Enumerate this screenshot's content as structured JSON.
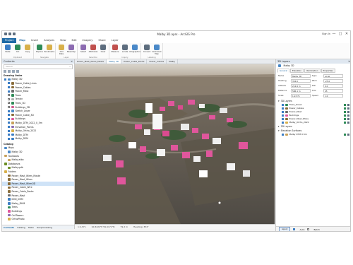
{
  "window": {
    "title": "Malby 3D.aprx - ArcGIS Pro",
    "sign_in": "Sign In",
    "min": "—",
    "max": "□",
    "close": "✕"
  },
  "ribbon_tabs": [
    "Project",
    "Map",
    "Insert",
    "Analysis",
    "View",
    "Edit",
    "Imagery",
    "Share",
    "Layer"
  ],
  "ribbon": {
    "groups": [
      {
        "name": "Clipboard",
        "buttons": [
          "Paste",
          "Cut",
          "Copy"
        ]
      },
      {
        "name": "Navigate",
        "buttons": [
          "Explore",
          "Bookmarks"
        ]
      },
      {
        "name": "Layer",
        "buttons": [
          "Add Data",
          "Basemap"
        ]
      },
      {
        "name": "Selection",
        "buttons": [
          "Select",
          "Attributes",
          "Clear"
        ]
      },
      {
        "name": "Inquiry",
        "buttons": [
          "Measure",
          "Locate",
          "Infographics"
        ]
      },
      {
        "name": "Labeling",
        "buttons": [
          "Convert",
          "Download Map"
        ]
      }
    ]
  },
  "left_pane": {
    "title": "Contents",
    "search_placeholder": "Search",
    "section_label": "Drawing Order",
    "items": [
      {
        "label": "Malby 3D",
        "level": 0,
        "checked": true,
        "color": "#4a89c8"
      },
      {
        "label": "Power_Cable_Lines",
        "level": 1,
        "checked": true,
        "color": "#8a6d3b"
      },
      {
        "label": "Power_Cables",
        "level": 1,
        "checked": true,
        "color": "#8a6d3b"
      },
      {
        "label": "Power_Mast",
        "level": 1,
        "checked": true,
        "color": "#6b6b6b"
      },
      {
        "label": "Trees",
        "level": 1,
        "checked": false,
        "color": "#2e8b57"
      },
      {
        "label": "Terrain",
        "level": 1,
        "checked": false,
        "color": "#b0b0b0"
      },
      {
        "label": "Trees_3D",
        "level": 1,
        "checked": false,
        "color": "#2e8b57"
      },
      {
        "label": "Buildings_3D",
        "level": 1,
        "checked": false,
        "color": "#d05b8f"
      },
      {
        "label": "Sketch_Layer",
        "level": 1,
        "checked": true,
        "color": "#4a89c8"
      },
      {
        "label": "Power_Cable_3D",
        "level": 1,
        "checked": true,
        "color": "#8a6d3b"
      },
      {
        "label": "Buildings",
        "level": 1,
        "checked": true,
        "color": "#e0569c"
      },
      {
        "label": "Malby_DTM_2022_0_5m",
        "level": 1,
        "checked": true,
        "color": "#c9a15b"
      },
      {
        "label": "Elevation_Points",
        "level": 1,
        "checked": true,
        "color": "#8c6bb1"
      },
      {
        "label": "Malby_Ortho_2022",
        "level": 1,
        "checked": true,
        "color": "#d8b04a"
      },
      {
        "label": "Malby_DTM",
        "level": 1,
        "checked": true,
        "color": "#3b7dc4"
      },
      {
        "label": "Malby_DSM",
        "level": 1,
        "checked": true,
        "color": "#3b7dc4"
      }
    ],
    "section2_label": "Catalog",
    "items2": [
      {
        "label": "Maps",
        "level": 0,
        "color": "#4a89c8"
      },
      {
        "label": "Malby 3D",
        "level": 1,
        "color": "#4a89c8"
      },
      {
        "label": "Toolboxes",
        "level": 0,
        "color": "#c9a15b"
      },
      {
        "label": "Malby.atbx",
        "level": 1,
        "color": "#c9a15b"
      },
      {
        "label": "Databases",
        "level": 0,
        "color": "#6b8e23"
      },
      {
        "label": "Malby.gdb",
        "level": 1,
        "color": "#6b8e23"
      },
      {
        "label": "Folders",
        "level": 0,
        "color": "#d8b04a"
      },
      {
        "label": "Power_Mast_Wires_Maste",
        "level": 1,
        "color": "#8a6d3b"
      },
      {
        "label": "Power_Mast_Wires",
        "level": 1,
        "color": "#8a6d3b"
      },
      {
        "label": "Power_Mast_Wires3D",
        "level": 1,
        "color": "#8a6d3b",
        "selected": true
      },
      {
        "label": "Power_Cable_Wire",
        "level": 1,
        "color": "#8a6d3b"
      },
      {
        "label": "Power_Cable_Route",
        "level": 1,
        "color": "#8a6d3b"
      },
      {
        "label": "Power_Mast",
        "level": 1,
        "color": "#6b6b6b"
      },
      {
        "label": "DVD_DHM",
        "level": 1,
        "color": "#3b7dc4"
      },
      {
        "label": "Malby_DHM",
        "level": 1,
        "color": "#3b7dc4"
      },
      {
        "label": "Trees",
        "level": 1,
        "color": "#2e8b57"
      },
      {
        "label": "Buildings",
        "level": 1,
        "color": "#e0569c"
      },
      {
        "label": "CellTowers",
        "level": 1,
        "color": "#8c6bb1"
      },
      {
        "label": "OrthoPhoto",
        "level": 1,
        "color": "#d8b04a"
      }
    ],
    "bottom_tabs": [
      "Contents",
      "Catalog",
      "Tasks",
      "Geoprocessing"
    ]
  },
  "view_tabs": [
    "Power_Mast_Wires_Maste",
    "Malby 3D",
    "Power_Cable_Route",
    "Power_Cables",
    "Malby"
  ],
  "map_status": {
    "scale": "1:2,371",
    "coords": "10.8224°E 59.9171°N",
    "elev": "79.2 m",
    "heading": "Heading: 354°"
  },
  "right_pane": {
    "title": "3D Layers",
    "scene_name": "Malby 3D",
    "tabs": [
      "General",
      "Elevation",
      "Illumination",
      "Properties"
    ],
    "fields": [
      {
        "label": "Name",
        "value": "Malby 3D",
        "label2": "Type",
        "value2": "Local"
      },
      {
        "label": "Heading",
        "value": "354.0",
        "label2": "Pitch",
        "value2": "-25.0"
      },
      {
        "label": "Altitude",
        "value": "212.6 m",
        "label2": "Roll",
        "value2": "0.0"
      },
      {
        "label": "Distance",
        "value": "586.1 m",
        "label2": "FOV",
        "value2": "45"
      },
      {
        "label": "Scale",
        "value": "1:2,371",
        "label2": "Speed",
        "value2": "1.0"
      }
    ],
    "section1": "3D Layers",
    "layers": [
      {
        "label": "Trees_Green",
        "color": "#2e8b57"
      },
      {
        "label": "Power_Cables",
        "color": "#8a6d3b"
      },
      {
        "label": "Power_Mast",
        "color": "#6b6b6b"
      },
      {
        "label": "Buildings",
        "color": "#e0569c"
      },
      {
        "label": "Power_Mast_Wires",
        "color": "#8a6d3b"
      },
      {
        "label": "Malby_Ortho_2022",
        "color": "#d8b04a"
      }
    ],
    "section2": "2D Layers",
    "section3": "Elevation Surfaces",
    "surfaces": [
      {
        "label": "Malby DTM 0.5m",
        "color": "#c9a15b"
      }
    ],
    "apply": "Apply",
    "auto_label": "Auto",
    "auto_checked": true,
    "batch_label": "Batch"
  },
  "colors": {
    "accent": "#1f6aa5",
    "building_pink": "#e0569c",
    "ground": "#57534c"
  }
}
